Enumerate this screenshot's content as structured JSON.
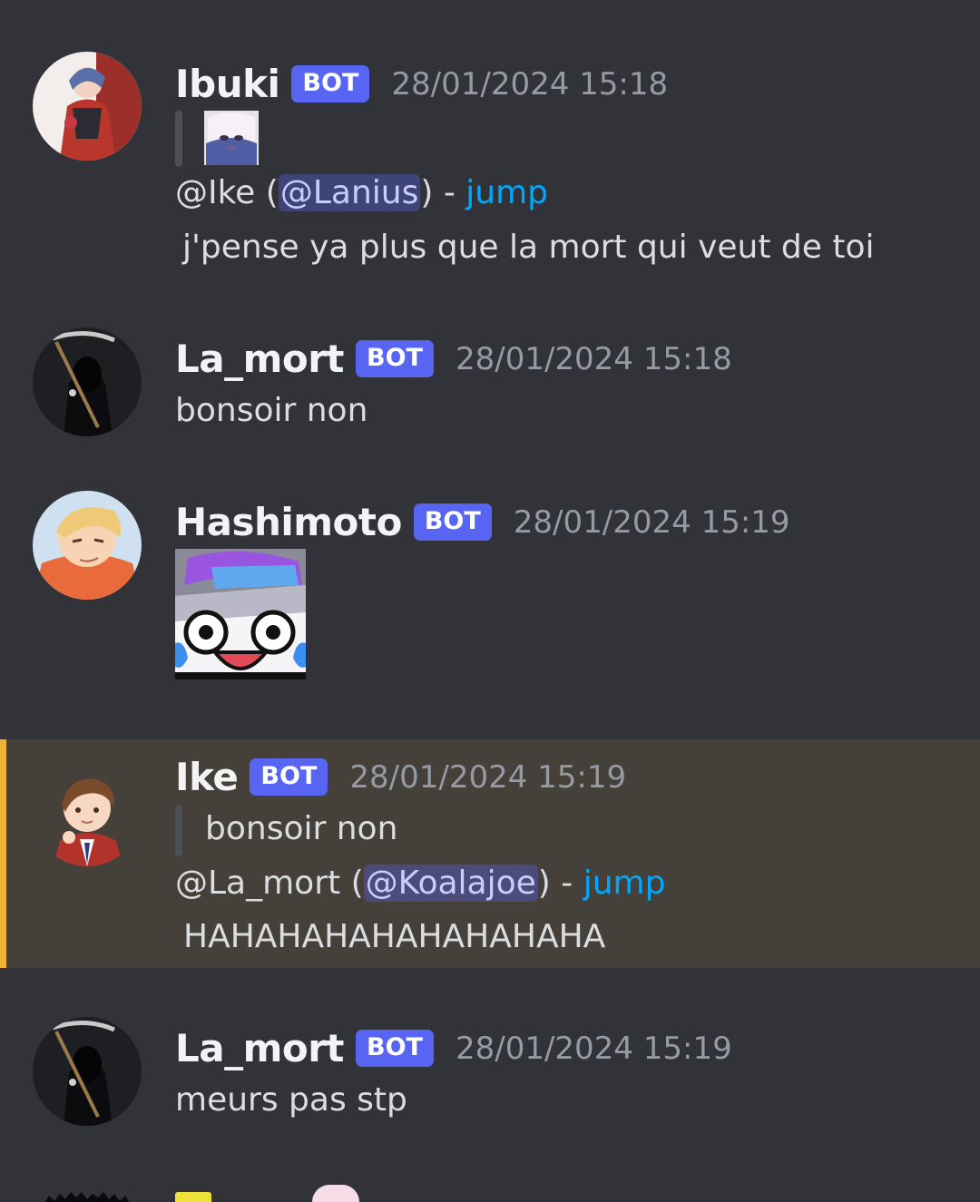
{
  "messages": [
    {
      "username": "Ibuki",
      "badge": "BOT",
      "timestamp": "28/01/2024 15:18",
      "reply_prefix": "@Ike (",
      "reply_mention": "@Lanius",
      "reply_suffix": ") - ",
      "jump": "jump",
      "text": "j'pense ya plus que la mort qui veut de toi"
    },
    {
      "username": "La_mort",
      "badge": "BOT",
      "timestamp": "28/01/2024 15:18",
      "text": "bonsoir non"
    },
    {
      "username": "Hashimoto",
      "badge": "BOT",
      "timestamp": "28/01/2024 15:19"
    },
    {
      "username": "Ike",
      "badge": "BOT",
      "timestamp": "28/01/2024 15:19",
      "quote": "bonsoir non",
      "reply_prefix": "@La_mort (",
      "reply_mention": "@Koalajoe",
      "reply_suffix": ") - ",
      "jump": "jump",
      "text": "HAHAHAHAHAHAHAHAHA"
    },
    {
      "username": "La_mort",
      "badge": "BOT",
      "timestamp": "28/01/2024 15:19",
      "text": "meurs pas stp"
    }
  ],
  "colors": {
    "background": "#313338",
    "highlight": "#46403a",
    "highlight_bar": "#f0b232",
    "badge": "#5865f2",
    "link": "#00a8fc"
  }
}
